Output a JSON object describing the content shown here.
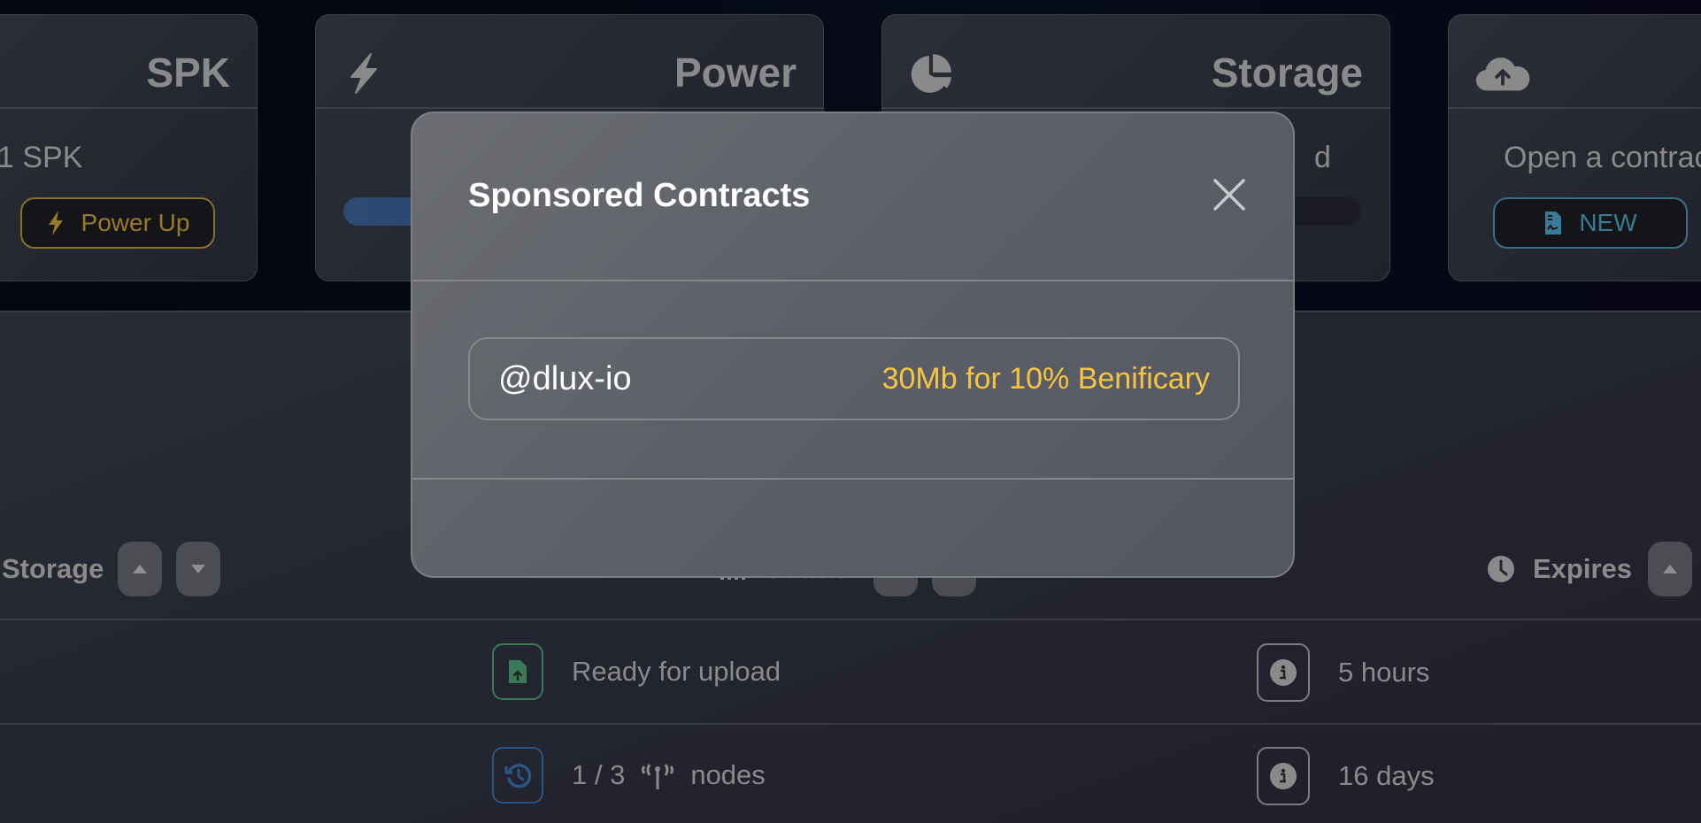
{
  "cards": {
    "spk": {
      "title": "SPK",
      "balance_text": "1 SPK",
      "button_label": "Power Up",
      "button_icon": "bolt-icon"
    },
    "power": {
      "title": "Power",
      "icon": "bolt-icon",
      "progress_fraction": 0.35
    },
    "storage": {
      "title": "Storage",
      "icon": "pie-chart-icon",
      "text_fragment": "d",
      "progress_fraction": 0.0
    },
    "contract": {
      "icon": "cloud-upload-icon",
      "text": "Open a contract",
      "button_label": "NEW",
      "button_icon": "file-contract-icon"
    }
  },
  "table": {
    "headers": [
      {
        "label": "Storage",
        "sort_asc_icon": "caret-up-icon",
        "sort_desc_icon": "caret-down-icon"
      },
      {
        "label": "Status",
        "icon": "signal-bars-icon"
      },
      {
        "label": "Expires",
        "icon": "clock-icon",
        "sort_asc_icon": "caret-up-icon"
      }
    ],
    "rows": [
      {
        "status_icon": "file-upload-icon",
        "status_text": "Ready for upload",
        "expires": "5 hours"
      },
      {
        "status_icon": "history-icon",
        "status_text": "1 / 3",
        "status_suffix": "nodes",
        "status_mid_icon": "antenna-icon",
        "expires": "16 days"
      }
    ]
  },
  "modal": {
    "title": "Sponsored Contracts",
    "close_icon": "close-icon",
    "sponsors": [
      {
        "user": "@dlux-io",
        "terms": "30Mb for 10% Benificary"
      }
    ]
  },
  "colors": {
    "accent_gold": "#f5c542",
    "power_up_gold": "#9a7a2a",
    "new_teal": "#3a7a96",
    "progress_blue": "#2c4a72",
    "status_green": "#3a7a58",
    "status_blue": "#2c5586"
  }
}
